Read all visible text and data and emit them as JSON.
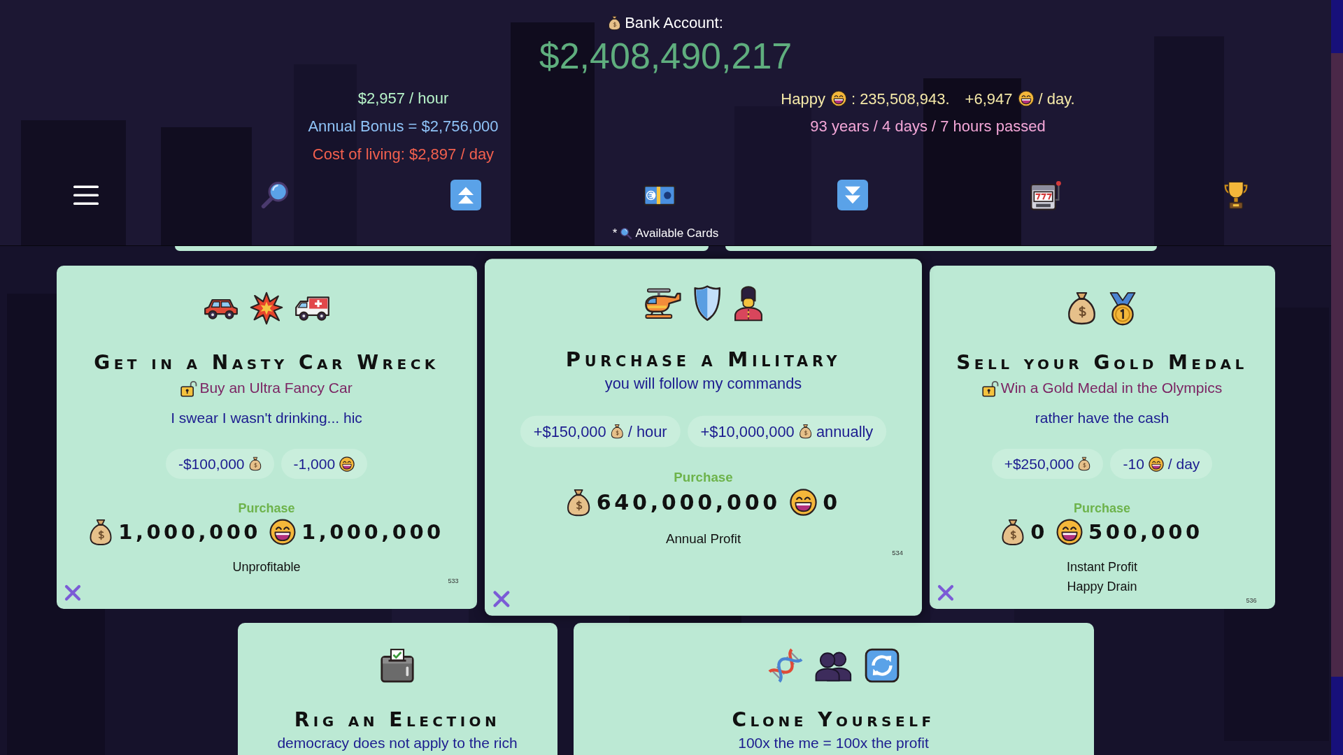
{
  "bank": {
    "label": "Bank Account:",
    "balance": "$2,408,490,217"
  },
  "income_stats": [
    {
      "kind": "income",
      "text": "$2,957 / hour"
    },
    {
      "kind": "bonus",
      "text": "Annual Bonus = $2,756,000"
    },
    {
      "kind": "cost",
      "text": "Cost of living: $2,897 / day"
    }
  ],
  "happiness": {
    "label": "Happy",
    "total": ": 235,508,943.",
    "rate": "+6,947",
    "rate_unit": "/ day."
  },
  "time_passed": "93 years / 4 days / 7 hours passed",
  "view": {
    "prefix": "*",
    "title": "Available Cards"
  },
  "cards": [
    {
      "title": "Get in a Nasty Car Wreck",
      "unlock": "Buy an Ultra Fancy Car",
      "tagline": "I swear I wasn't drinking... hic",
      "effects": [
        {
          "kind": "money",
          "amount": "-$100,000"
        },
        {
          "kind": "happy",
          "amount": "-1,000"
        }
      ],
      "purchase_label": "Purchase",
      "price": {
        "money": "1,000,000",
        "happy": "1,000,000"
      },
      "notes": [
        "Unprofitable"
      ],
      "number": "533",
      "dismissible": true,
      "hovered": false
    },
    {
      "title": "Purchase a Military",
      "tagline": "you will follow my commands",
      "effects": [
        {
          "kind": "money",
          "amount": "+$150,000",
          "unit": "/ hour"
        },
        {
          "kind": "money",
          "amount": "+$10,000,000",
          "unit": "annually"
        }
      ],
      "purchase_label": "Purchase",
      "price": {
        "money": "640,000,000",
        "happy": "0"
      },
      "notes": [
        "Annual Profit"
      ],
      "number": "534",
      "dismissible": true,
      "hovered": true
    },
    {
      "title": "Sell your Gold Medal",
      "unlock": "Win a Gold Medal in the Olympics",
      "tagline": "rather have the cash",
      "effects": [
        {
          "kind": "money",
          "amount": "+$250,000"
        },
        {
          "kind": "happy",
          "amount": "-10",
          "unit": "/ day"
        }
      ],
      "purchase_label": "Purchase",
      "price": {
        "money": "0",
        "happy": "500,000"
      },
      "notes": [
        "Instant Profit",
        "Happy Drain"
      ],
      "number": "536",
      "dismissible": true,
      "hovered": false
    },
    {
      "title": "Rig an Election",
      "tagline": "democracy does not apply to the rich",
      "hovered": false
    },
    {
      "title": "Clone Yourself",
      "tagline": "100x the me = 100x the profit",
      "hovered": false
    }
  ]
}
